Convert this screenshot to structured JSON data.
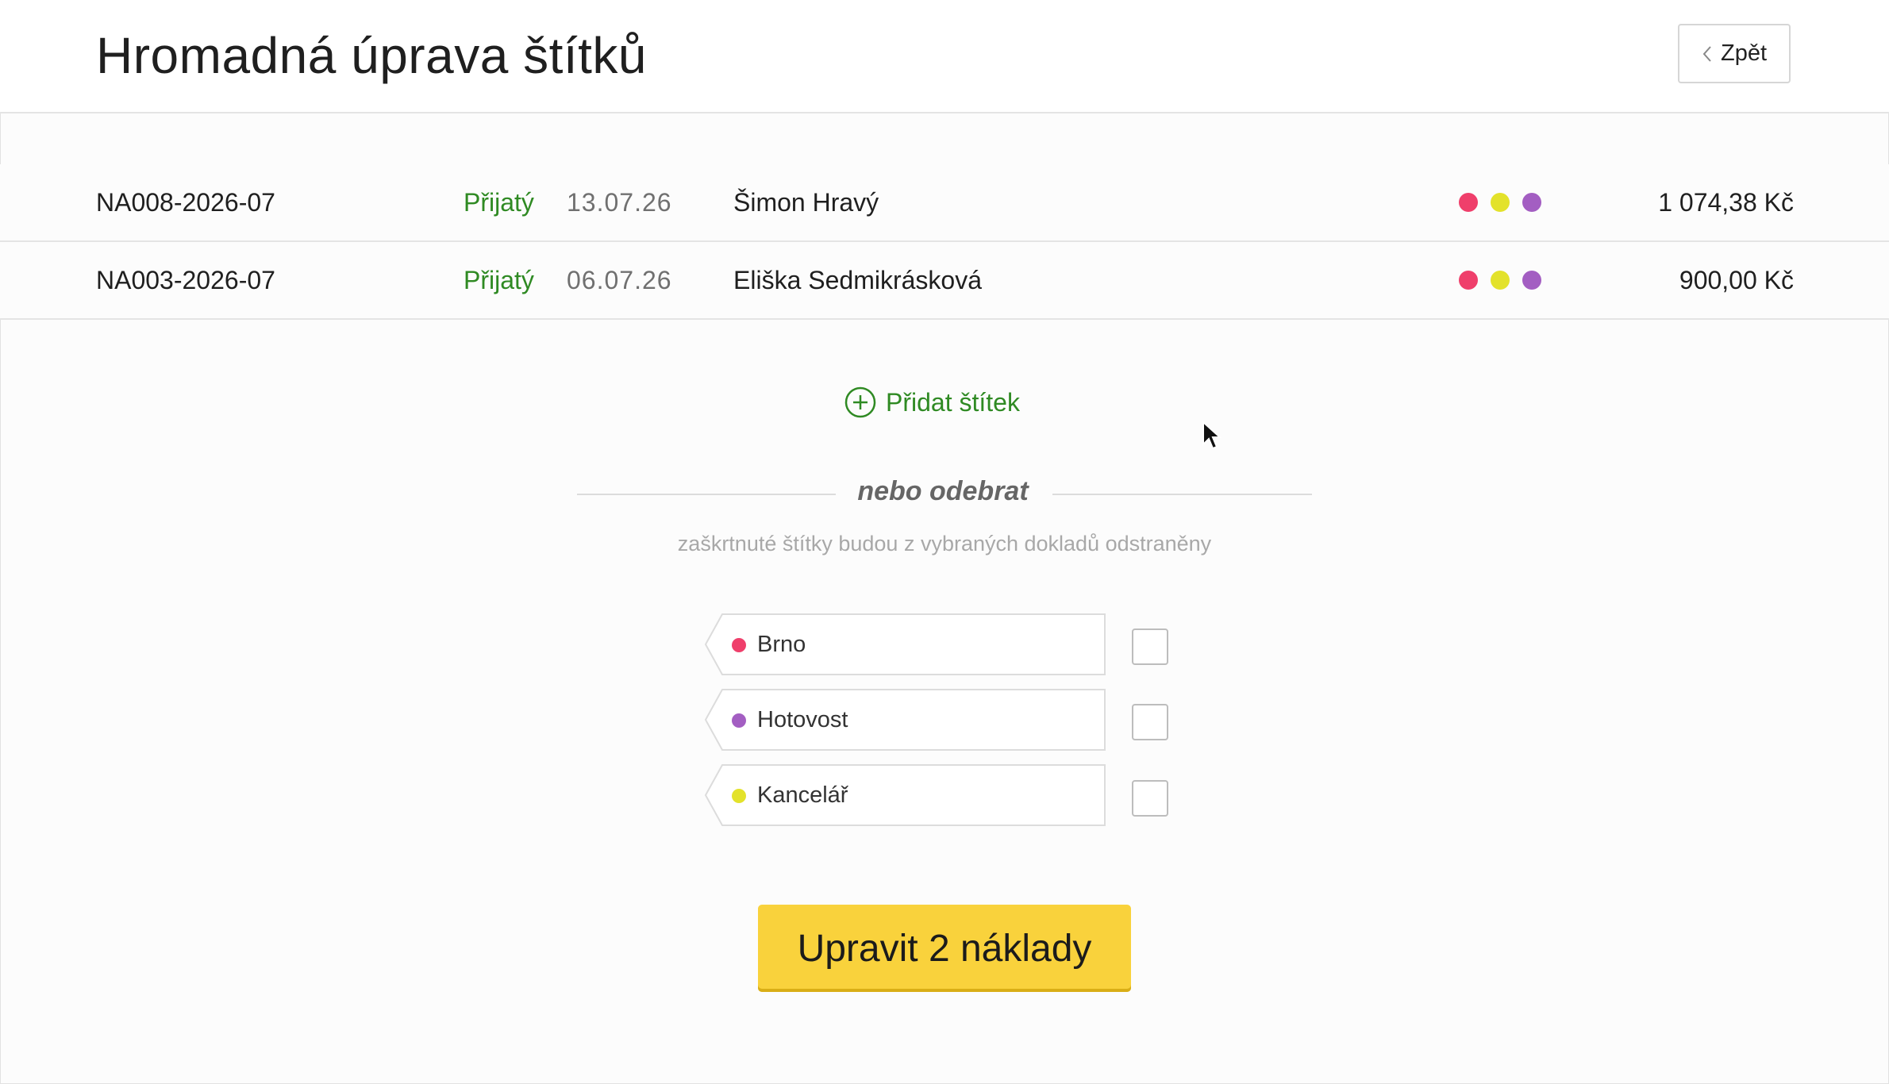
{
  "header": {
    "title": "Hromadná úprava štítků",
    "back_label": "Zpět"
  },
  "documents": [
    {
      "number": "NA008-2026-07",
      "status": "Přijatý",
      "date": "13.07.26",
      "name": "Šimon Hravý",
      "tag_colors": [
        "#ef3f6b",
        "#e3e22b",
        "#a35ec2"
      ],
      "amount": "1 074,38 Kč"
    },
    {
      "number": "NA003-2026-07",
      "status": "Přijatý",
      "date": "06.07.26",
      "name": "Eliška Sedmikrásková",
      "tag_colors": [
        "#ef3f6b",
        "#e3e22b",
        "#a35ec2"
      ],
      "amount": "900,00 Kč"
    }
  ],
  "add_tag_label": "Přidat štítek",
  "remove_section": {
    "title": "nebo odebrat",
    "hint": "zaškrtnuté štítky budou z vybraných dokladů odstraněny"
  },
  "tags": [
    {
      "label": "Brno",
      "color": "#ef3f6b",
      "checked": false
    },
    {
      "label": "Hotovost",
      "color": "#a35ec2",
      "checked": false
    },
    {
      "label": "Kancelář",
      "color": "#e3e22b",
      "checked": false
    }
  ],
  "submit_label": "Upravit 2 náklady",
  "colors": {
    "status_green": "#2f8a23",
    "primary_yellow": "#f9d23c"
  }
}
